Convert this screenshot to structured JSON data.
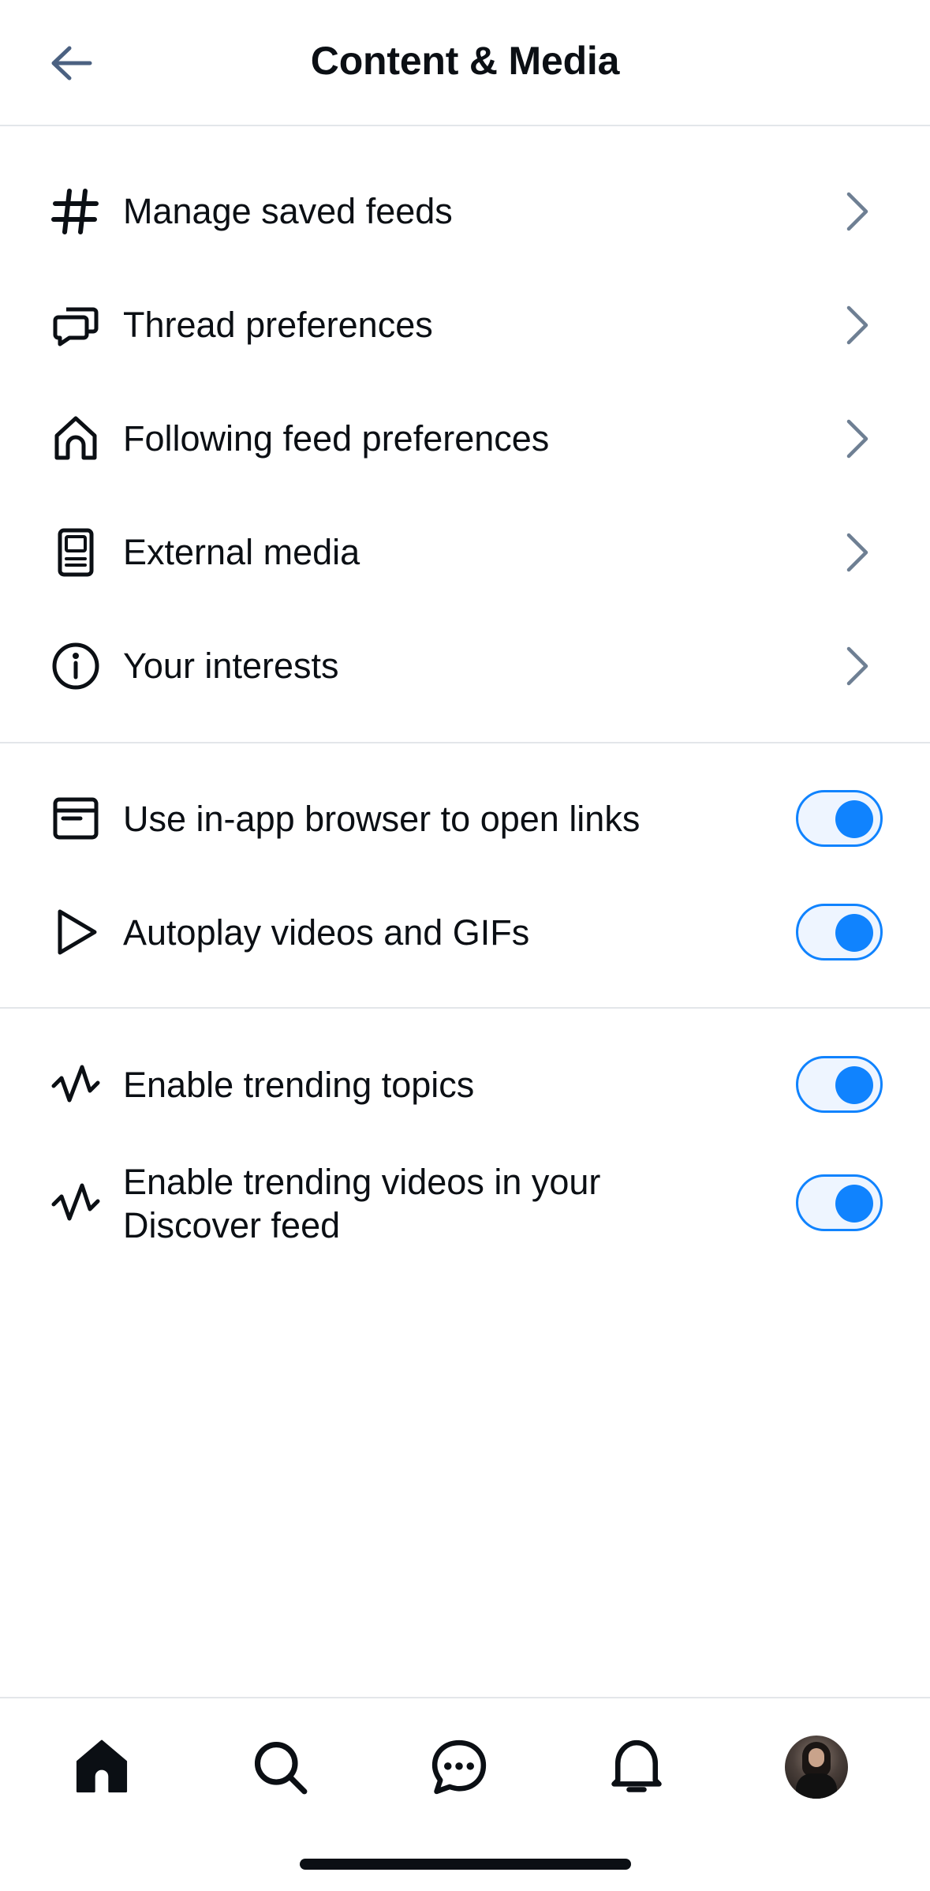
{
  "header": {
    "title": "Content & Media",
    "back_icon": "arrow-left-icon"
  },
  "navigation_rows": [
    {
      "label": "Manage saved feeds",
      "icon": "hashtag-icon"
    },
    {
      "label": "Thread preferences",
      "icon": "chat-bubbles-icon"
    },
    {
      "label": "Following feed preferences",
      "icon": "home-outline-icon"
    },
    {
      "label": "External media",
      "icon": "media-device-icon"
    },
    {
      "label": "Your interests",
      "icon": "info-circle-icon"
    }
  ],
  "toggle_rows": [
    {
      "label": "Use in-app browser to open links",
      "icon": "browser-window-icon",
      "enabled": true
    },
    {
      "label": "Autoplay videos and GIFs",
      "icon": "play-icon",
      "enabled": true
    }
  ],
  "trending_rows": [
    {
      "label": "Enable trending topics",
      "icon": "trending-wave-icon",
      "enabled": true
    },
    {
      "label_line1": "Enable trending videos in your",
      "label_line2": "Discover feed",
      "icon": "trending-wave-icon",
      "enabled": true
    }
  ],
  "tabbar": {
    "items": [
      "home-icon",
      "search-icon",
      "chat-icon",
      "bell-icon",
      "avatar"
    ]
  },
  "colors": {
    "accent": "#1083fe",
    "text": "#0b0f14",
    "chevron": "#6e7f93",
    "divider": "#e3e6ea"
  }
}
